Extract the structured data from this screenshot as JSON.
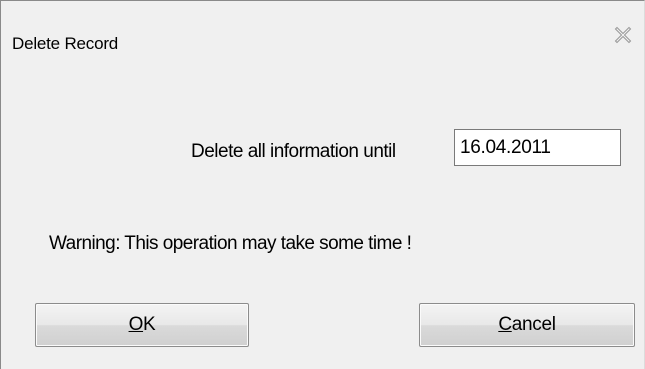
{
  "window": {
    "title": "Delete Record",
    "close_icon": "close-icon"
  },
  "form": {
    "label": "Delete all information until",
    "date_value": "16.04.2011"
  },
  "warning": "Warning: This operation may take some time !",
  "buttons": {
    "ok": {
      "mnemonic": "O",
      "rest": "K"
    },
    "cancel": {
      "mnemonic": "C",
      "rest": "ancel"
    }
  }
}
